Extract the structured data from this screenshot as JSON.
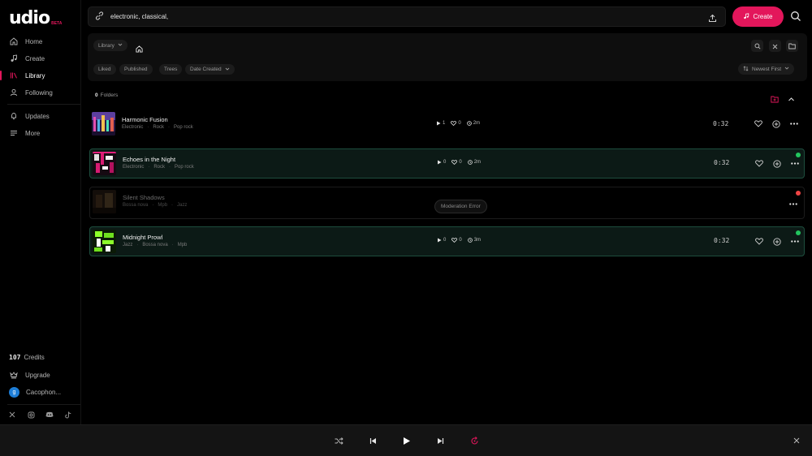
{
  "app": {
    "logo": "udio",
    "badge": "BETA"
  },
  "sidebar": {
    "items": [
      {
        "label": "Home",
        "icon": "home-icon"
      },
      {
        "label": "Create",
        "icon": "music-note-icon"
      },
      {
        "label": "Library",
        "icon": "library-icon",
        "active": true
      },
      {
        "label": "Following",
        "icon": "user-icon"
      },
      {
        "label": "Updates",
        "icon": "bell-icon"
      },
      {
        "label": "More",
        "icon": "menu-icon"
      }
    ],
    "credits_value": "107",
    "credits_label": "Credits",
    "upgrade_label": "Upgrade",
    "user_initial": "g",
    "user_name": "Cacophon...",
    "socials": [
      "x-icon",
      "instagram-icon",
      "discord-icon",
      "tiktok-icon"
    ]
  },
  "search": {
    "value": "electronic, classical,"
  },
  "create_button": {
    "label": "Create"
  },
  "filters": {
    "breadcrumb_root": "Library",
    "chips": [
      "Liked",
      "Published",
      "Trees",
      "Date Created"
    ],
    "sort": "Newest First"
  },
  "folders": {
    "count": "0",
    "label": "Folders"
  },
  "tracks": [
    {
      "title": "Harmonic Fusion",
      "genres": [
        "Electronic",
        "Rock",
        "Pop rock"
      ],
      "plays": "1",
      "likes": "0",
      "age": "2m",
      "duration": "0:32",
      "status": "none"
    },
    {
      "title": "Echoes in the Night",
      "genres": [
        "Electronic",
        "Rock",
        "Pop rock"
      ],
      "plays": "0",
      "likes": "0",
      "age": "2m",
      "duration": "0:32",
      "status": "ok"
    },
    {
      "title": "Silent Shadows",
      "genres": [
        "Bossa nova",
        "Mpb",
        "Jazz"
      ],
      "badge": "Moderation Error",
      "status": "error"
    },
    {
      "title": "Midnight Prowl",
      "genres": [
        "Jazz",
        "Bossa nova",
        "Mpb"
      ],
      "plays": "0",
      "likes": "0",
      "age": "3m",
      "duration": "0:32",
      "status": "ok"
    }
  ],
  "colors": {
    "accent": "#e3165b",
    "ok": "#22c55e",
    "error": "#ef4444",
    "selected_border": "#1d4d3d"
  }
}
